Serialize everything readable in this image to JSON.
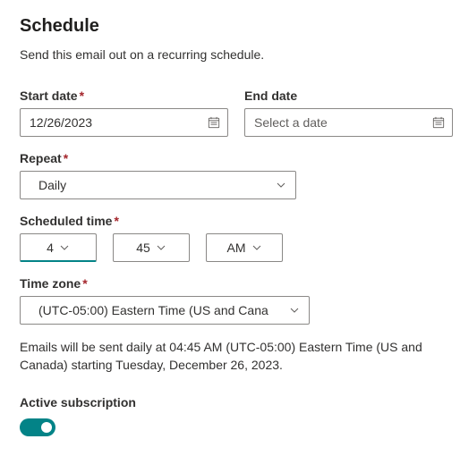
{
  "heading": "Schedule",
  "description": "Send this email out on a recurring schedule.",
  "fields": {
    "startDate": {
      "label": "Start date",
      "value": "12/26/2023"
    },
    "endDate": {
      "label": "End date",
      "placeholder": "Select a date"
    },
    "repeat": {
      "label": "Repeat",
      "value": "Daily"
    },
    "scheduledTime": {
      "label": "Scheduled time",
      "hour": "4",
      "minute": "45",
      "ampm": "AM"
    },
    "timeZone": {
      "label": "Time zone",
      "value": "(UTC-05:00) Eastern Time (US and Cana"
    }
  },
  "summary": "Emails will be sent daily at 04:45 AM (UTC-05:00) Eastern Time (US and Canada) starting Tuesday, December 26, 2023.",
  "activeSubscription": {
    "label": "Active subscription",
    "enabled": true
  }
}
